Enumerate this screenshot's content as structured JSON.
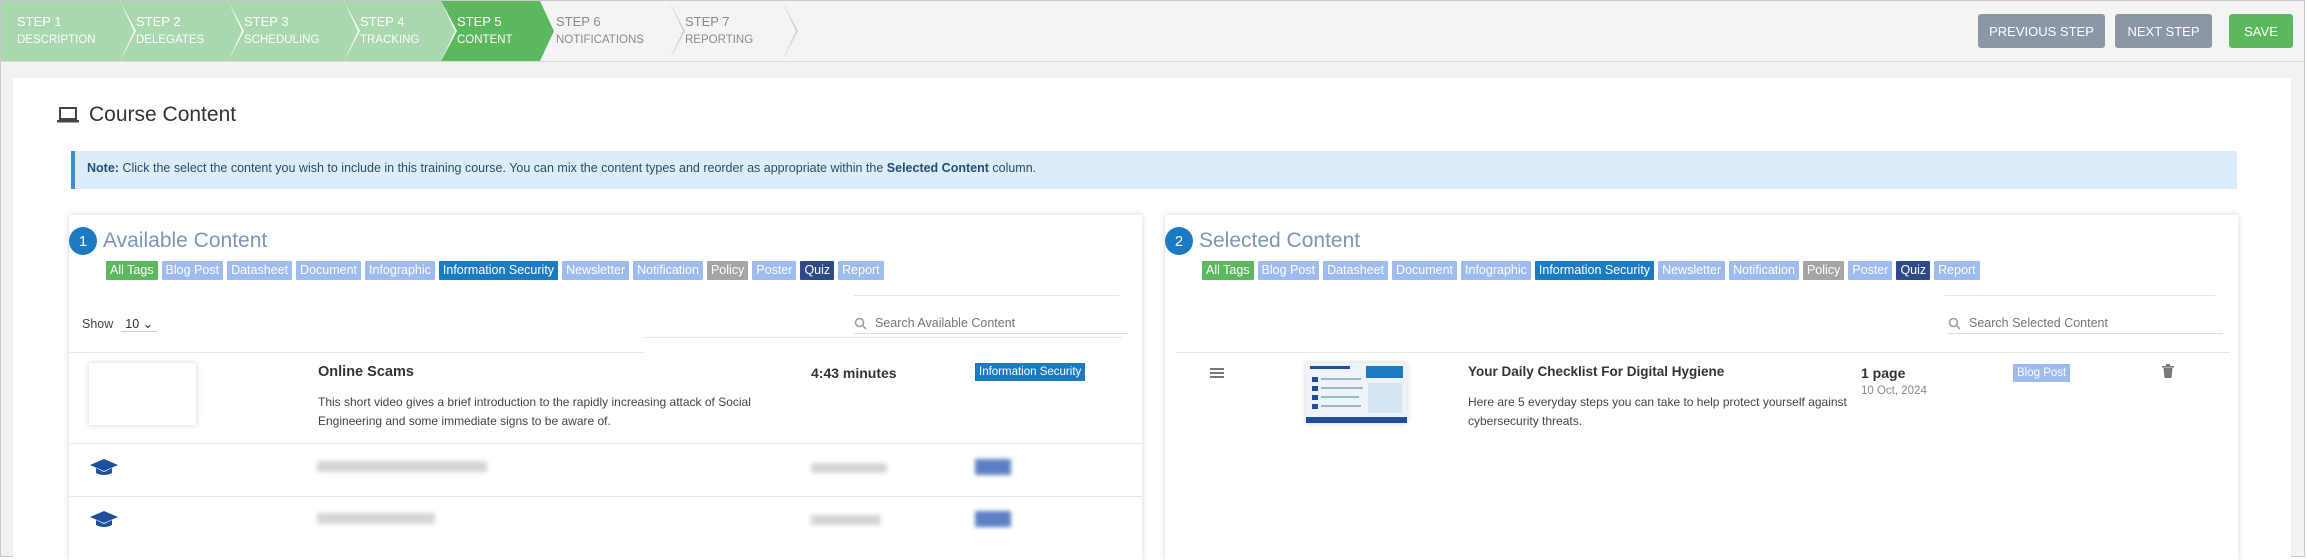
{
  "steps": [
    {
      "step": "STEP 1",
      "name": "DESCRIPTION",
      "state": "done"
    },
    {
      "step": "STEP 2",
      "name": "DELEGATES",
      "state": "done"
    },
    {
      "step": "STEP 3",
      "name": "SCHEDULING",
      "state": "done"
    },
    {
      "step": "STEP 4",
      "name": "TRACKING",
      "state": "done"
    },
    {
      "step": "STEP 5",
      "name": "CONTENT",
      "state": "active"
    },
    {
      "step": "STEP 6",
      "name": "NOTIFICATIONS",
      "state": "todo"
    },
    {
      "step": "STEP 7",
      "name": "REPORTING",
      "state": "todo"
    }
  ],
  "buttons": {
    "previous": "PREVIOUS STEP",
    "next": "NEXT STEP",
    "save": "SAVE"
  },
  "page": {
    "title": "Course Content",
    "icon": "laptop-icon"
  },
  "note": {
    "label": "Note:",
    "text_before": "Click the select the content you wish to include in this training course. You can mix the content types and reorder as appropriate within the",
    "bold": "Selected Content",
    "text_after": "column."
  },
  "tags": [
    {
      "label": "All Tags",
      "color": "#5cb85c"
    },
    {
      "label": "Blog Post",
      "color": "#9dbbee"
    },
    {
      "label": "Datasheet",
      "color": "#9dbbee"
    },
    {
      "label": "Document",
      "color": "#9dbbee"
    },
    {
      "label": "Infographic",
      "color": "#9dbbee"
    },
    {
      "label": "Information Security",
      "color": "#1a7bc3"
    },
    {
      "label": "Newsletter",
      "color": "#9dbbee"
    },
    {
      "label": "Notification",
      "color": "#9dbbee"
    },
    {
      "label": "Policy",
      "color": "#a5a5a5"
    },
    {
      "label": "Poster",
      "color": "#9dbbee"
    },
    {
      "label": "Quiz",
      "color": "#2e4a8a"
    },
    {
      "label": "Report",
      "color": "#9dbbee"
    }
  ],
  "available": {
    "number": "1",
    "title": "Available Content",
    "show_label": "Show",
    "page_size": "10",
    "search_placeholder": "Search Available Content",
    "item": {
      "title": "Online Scams",
      "description_1": "This short video gives a brief introduction to the rapidly increasing attack of Social",
      "description_2": "Engineering and some immediate signs to be aware of.",
      "duration": "4:43 minutes",
      "tag": "Information Security"
    }
  },
  "selected": {
    "number": "2",
    "title": "Selected Content",
    "search_placeholder": "Search Selected Content",
    "item": {
      "title": "Your Daily Checklist For Digital Hygiene",
      "description_1": "Here are 5 everyday steps you can take to help protect yourself against",
      "description_2": "cybersecurity threats.",
      "pages": "1 page",
      "date": "10 Oct, 2024",
      "tag": "Blog Post"
    }
  },
  "colors": {
    "accent": "#1a7bc3",
    "success": "#5cb85c",
    "step_done": "#a9d8ae",
    "muted_button": "#8b97a7"
  }
}
